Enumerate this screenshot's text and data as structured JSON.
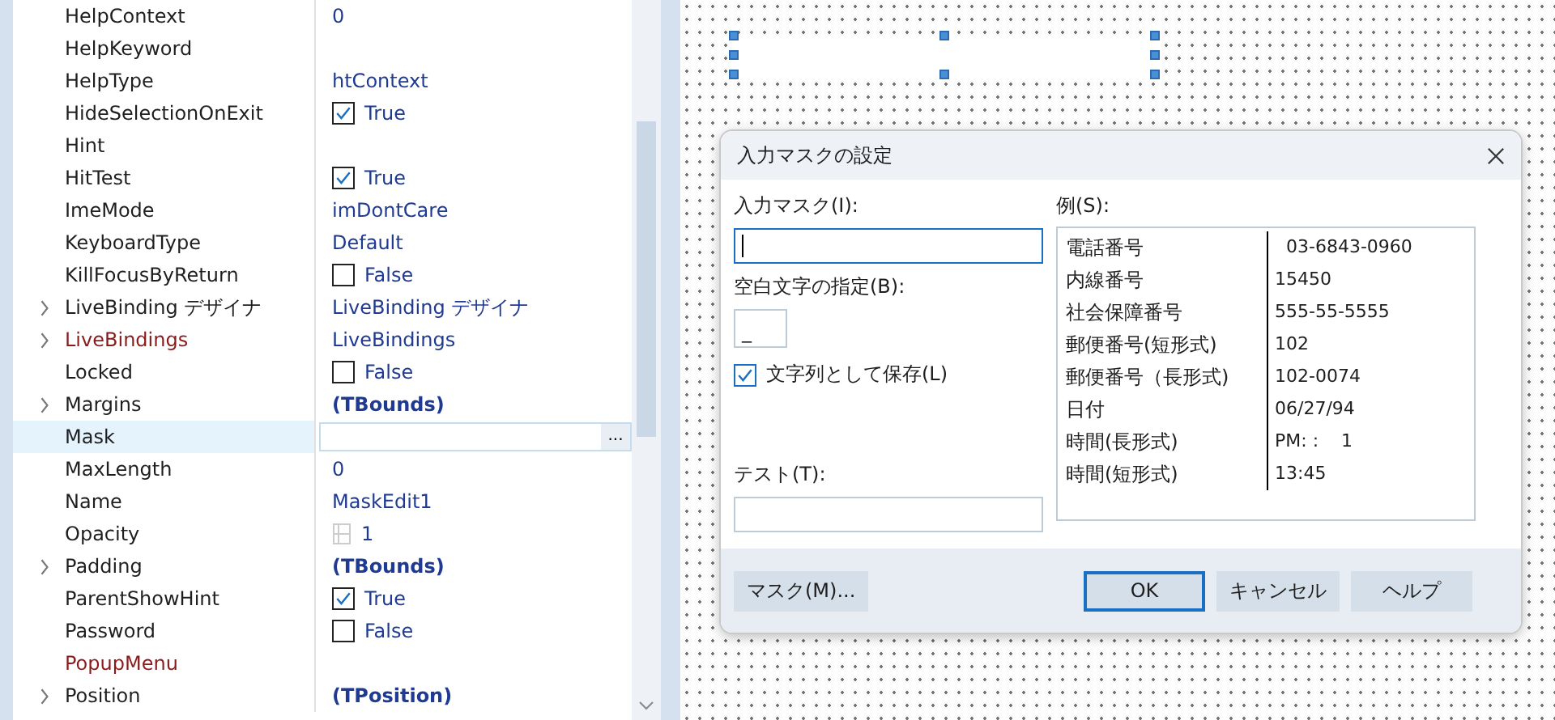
{
  "inspector": {
    "rows": [
      {
        "name": "HelpContext",
        "expandable": false,
        "linked": false,
        "selected": false,
        "value": {
          "kind": "text",
          "text": "0"
        }
      },
      {
        "name": "HelpKeyword",
        "expandable": false,
        "linked": false,
        "selected": false,
        "value": {
          "kind": "none"
        }
      },
      {
        "name": "HelpType",
        "expandable": false,
        "linked": false,
        "selected": false,
        "value": {
          "kind": "text",
          "text": "htContext"
        }
      },
      {
        "name": "HideSelectionOnExit",
        "expandable": false,
        "linked": false,
        "selected": false,
        "value": {
          "kind": "check",
          "checked": true,
          "text": "True"
        }
      },
      {
        "name": "Hint",
        "expandable": false,
        "linked": false,
        "selected": false,
        "value": {
          "kind": "none"
        }
      },
      {
        "name": "HitTest",
        "expandable": false,
        "linked": false,
        "selected": false,
        "value": {
          "kind": "check",
          "checked": true,
          "text": "True"
        }
      },
      {
        "name": "ImeMode",
        "expandable": false,
        "linked": false,
        "selected": false,
        "value": {
          "kind": "text",
          "text": "imDontCare"
        }
      },
      {
        "name": "KeyboardType",
        "expandable": false,
        "linked": false,
        "selected": false,
        "value": {
          "kind": "text",
          "text": "Default"
        }
      },
      {
        "name": "KillFocusByReturn",
        "expandable": false,
        "linked": false,
        "selected": false,
        "value": {
          "kind": "check",
          "checked": false,
          "text": "False"
        }
      },
      {
        "name": "LiveBinding デザイナ",
        "expandable": true,
        "linked": false,
        "selected": false,
        "value": {
          "kind": "text",
          "text": "LiveBinding デザイナ"
        }
      },
      {
        "name": "LiveBindings",
        "expandable": true,
        "linked": true,
        "selected": false,
        "value": {
          "kind": "text",
          "text": "LiveBindings"
        }
      },
      {
        "name": "Locked",
        "expandable": false,
        "linked": false,
        "selected": false,
        "value": {
          "kind": "check",
          "checked": false,
          "text": "False"
        }
      },
      {
        "name": "Margins",
        "expandable": true,
        "linked": false,
        "selected": false,
        "value": {
          "kind": "bold",
          "text": "(TBounds)"
        }
      },
      {
        "name": "Mask",
        "expandable": false,
        "linked": false,
        "selected": true,
        "value": {
          "kind": "editor",
          "button": "..."
        }
      },
      {
        "name": "MaxLength",
        "expandable": false,
        "linked": false,
        "selected": false,
        "value": {
          "kind": "text",
          "text": "0"
        }
      },
      {
        "name": "Name",
        "expandable": false,
        "linked": false,
        "selected": false,
        "value": {
          "kind": "text",
          "text": "MaskEdit1"
        }
      },
      {
        "name": "Opacity",
        "expandable": false,
        "linked": false,
        "selected": false,
        "value": {
          "kind": "spin",
          "text": "1"
        }
      },
      {
        "name": "Padding",
        "expandable": true,
        "linked": false,
        "selected": false,
        "value": {
          "kind": "bold",
          "text": "(TBounds)"
        }
      },
      {
        "name": "ParentShowHint",
        "expandable": false,
        "linked": false,
        "selected": false,
        "value": {
          "kind": "check",
          "checked": true,
          "text": "True"
        }
      },
      {
        "name": "Password",
        "expandable": false,
        "linked": false,
        "selected": false,
        "value": {
          "kind": "check",
          "checked": false,
          "text": "False"
        }
      },
      {
        "name": "PopupMenu",
        "expandable": false,
        "linked": true,
        "selected": false,
        "value": {
          "kind": "none"
        }
      },
      {
        "name": "Position",
        "expandable": true,
        "linked": false,
        "selected": false,
        "value": {
          "kind": "bold",
          "text": "(TPosition)"
        }
      }
    ]
  },
  "dialog": {
    "title": "入力マスクの設定",
    "mask_label": "入力マスク(I):",
    "blank_label": "空白文字の指定(B):",
    "blank_value": "_",
    "save_literal": {
      "label": "文字列として保存(L)",
      "checked": true
    },
    "test_label": "テスト(T):",
    "examples_label": "例(S):",
    "examples": [
      {
        "name": "電話番号",
        "sample": "  03-6843-0960"
      },
      {
        "name": "内線番号",
        "sample": "15450"
      },
      {
        "name": "社会保障番号",
        "sample": "555-55-5555"
      },
      {
        "name": "郵便番号(短形式)",
        "sample": "102"
      },
      {
        "name": "郵便番号（長形式)",
        "sample": "102-0074"
      },
      {
        "name": "日付",
        "sample": "06/27/94"
      },
      {
        "name": "時間(長形式)",
        "sample": "PM: :    1"
      },
      {
        "name": "時間(短形式)",
        "sample": "13:45"
      }
    ],
    "buttons": [
      {
        "label": "マスク(M)...",
        "default": false
      },
      {
        "label": "OK",
        "default": true
      },
      {
        "label": "キャンセル",
        "default": false
      },
      {
        "label": "ヘルプ",
        "default": false
      }
    ]
  }
}
